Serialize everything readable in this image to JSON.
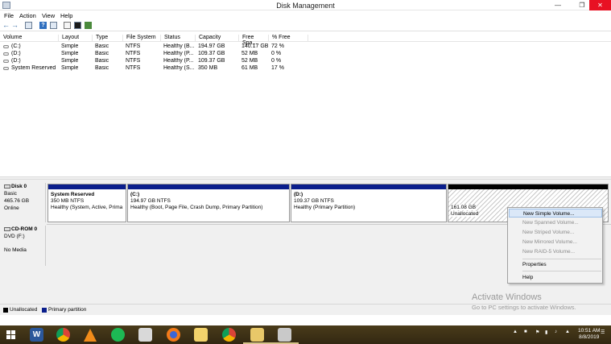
{
  "window": {
    "title": "Disk Management"
  },
  "menu": [
    "File",
    "Action",
    "View",
    "Help"
  ],
  "toolbar_icons": [
    "back-arrow-icon",
    "forward-arrow-icon",
    "panel-icon",
    "help-icon",
    "panel-icon",
    "document-icon",
    "properties-icon",
    "checkmark-icon"
  ],
  "columns": [
    "Volume",
    "Layout",
    "Type",
    "File System",
    "Status",
    "Capacity",
    "Free Spa...",
    "% Free"
  ],
  "volumes": [
    {
      "volume": "(C:)",
      "layout": "Simple",
      "type": "Basic",
      "fs": "NTFS",
      "status": "Healthy (B...",
      "capacity": "194.97 GB",
      "free": "140.17 GB",
      "pct": "72 %"
    },
    {
      "volume": "(D:)",
      "layout": "Simple",
      "type": "Basic",
      "fs": "NTFS",
      "status": "Healthy (P...",
      "capacity": "109.37 GB",
      "free": "52 MB",
      "pct": "0 %"
    },
    {
      "volume": "(D:)",
      "layout": "Simple",
      "type": "Basic",
      "fs": "NTFS",
      "status": "Healthy (P...",
      "capacity": "109.37 GB",
      "free": "52 MB",
      "pct": "0 %"
    },
    {
      "volume": "System Reserved",
      "layout": "Simple",
      "type": "Basic",
      "fs": "NTFS",
      "status": "Healthy (S...",
      "capacity": "350 MB",
      "free": "61 MB",
      "pct": "17 %"
    }
  ],
  "disk0": {
    "name": "Disk 0",
    "type": "Basic",
    "size": "465.76 GB",
    "state": "Online",
    "partitions": [
      {
        "name": "System Reserved",
        "size": "350 MB NTFS",
        "status": "Healthy (System, Active, Prima"
      },
      {
        "name": "(C:)",
        "size": "194.97 GB NTFS",
        "status": "Healthy (Boot, Page File, Crash Dump, Primary Partition)"
      },
      {
        "name": "(D:)",
        "size": "109.37 GB NTFS",
        "status": "Healthy (Primary Partition)"
      },
      {
        "name": "",
        "size": "161.08 GB",
        "status": "Unallocated"
      }
    ]
  },
  "cdrom": {
    "name": "CD-ROM 0",
    "type": "DVD (F:)",
    "state": "No Media"
  },
  "legend": {
    "unallocated": "Unallocated",
    "primary": "Primary partition"
  },
  "context_menu": [
    {
      "label": "New Simple Volume...",
      "enabled": true,
      "highlighted": true
    },
    {
      "label": "New Spanned Volume...",
      "enabled": false
    },
    {
      "label": "New Striped Volume...",
      "enabled": false
    },
    {
      "label": "New Mirrored Volume...",
      "enabled": false
    },
    {
      "label": "New RAID-5 Volume...",
      "enabled": false
    },
    {
      "label": "Properties",
      "enabled": true
    },
    {
      "label": "Help",
      "enabled": true
    }
  ],
  "watermark": {
    "line1": "Activate Windows",
    "line2": "Go to PC settings to activate Windows."
  },
  "taskbar": {
    "apps": [
      "word-icon",
      "chrome-icon",
      "vlc-icon",
      "spotify-icon",
      "app-icon",
      "firefox-icon",
      "folder-icon",
      "chrome-icon",
      "file-explorer-icon",
      "disk-management-icon"
    ],
    "time": "10:51 AM",
    "date": "8/8/2019"
  },
  "colors": {
    "primary_partition": "#0a1e8c",
    "unallocated": "#000000",
    "close_button": "#e81123",
    "menu_highlight": "#dbe8f8"
  }
}
